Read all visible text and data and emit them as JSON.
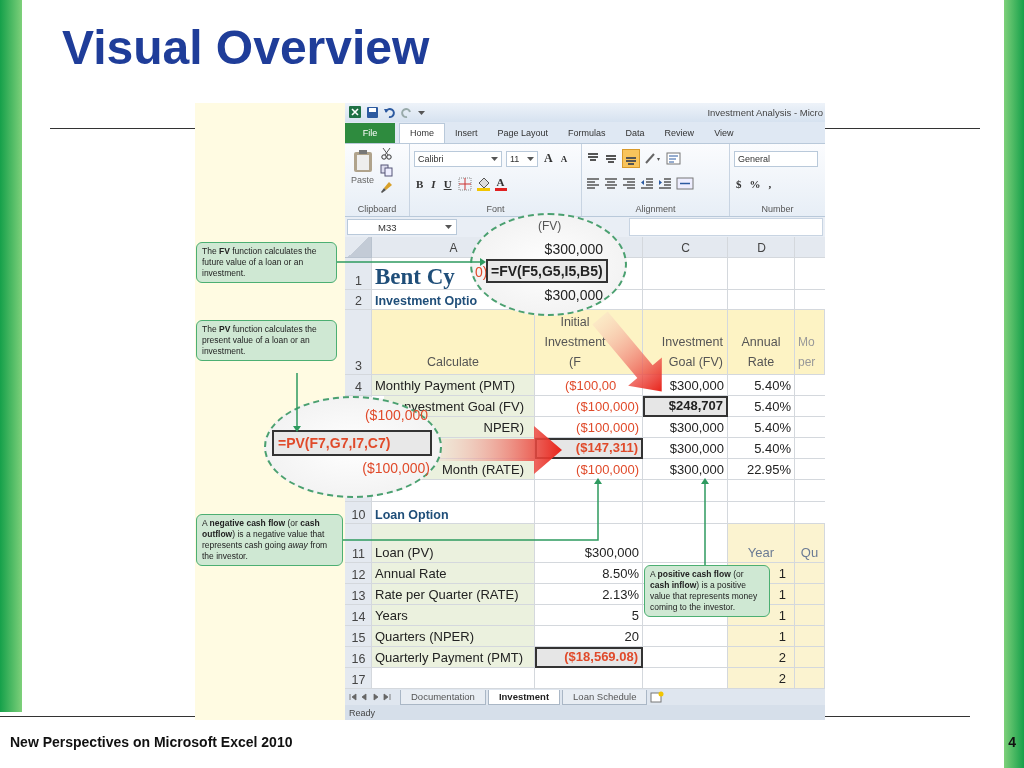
{
  "slide": {
    "title": "Visual Overview",
    "footer": "New Perspectives on Microsoft Excel 2010",
    "page_number": "4"
  },
  "excel": {
    "window_title": "Investment Analysis - Micro",
    "ribbon_tabs": [
      {
        "label": "File",
        "kind": "file",
        "selected": false
      },
      {
        "label": "Home",
        "kind": "tab",
        "selected": true
      },
      {
        "label": "Insert",
        "kind": "tab",
        "selected": false
      },
      {
        "label": "Page Layout",
        "kind": "tab",
        "selected": false
      },
      {
        "label": "Formulas",
        "kind": "tab",
        "selected": false
      },
      {
        "label": "Data",
        "kind": "tab",
        "selected": false
      },
      {
        "label": "Review",
        "kind": "tab",
        "selected": false
      },
      {
        "label": "View",
        "kind": "tab",
        "selected": false
      }
    ],
    "ribbon": {
      "paste": "Paste",
      "font_name": "Calibri",
      "font_size": "11",
      "grow": "A",
      "shrink": "A",
      "bold": "B",
      "italic": "I",
      "underline": "U",
      "font_color": "A",
      "bottom_align_selected": true,
      "number_format": "General",
      "currency": "$",
      "percent": "%",
      "comma": ",",
      "groups": [
        "Clipboard",
        "Font",
        "Alignment",
        "Number"
      ]
    },
    "name_box": "M33",
    "column_headers": {
      "a": "A",
      "c": "C",
      "d": "D"
    },
    "rows": [
      {
        "kind": "title",
        "number": "1",
        "a": {
          "kind": "title",
          "text": "Bent Cy"
        }
      },
      {
        "kind": "sub",
        "number": "2",
        "a": {
          "kind": "subtitle",
          "text": "Investment Optio"
        }
      },
      {
        "kind": "header",
        "number": "3",
        "a": {
          "kind": "header",
          "text": "Calculate"
        },
        "b": {
          "kind": "header",
          "text": "Initial Investment (F"
        },
        "c": {
          "kind": "header",
          "text": "Investment Goal (FV)"
        },
        "d": {
          "kind": "header",
          "text": "Annual Rate"
        },
        "e": {
          "kind": "faded",
          "text": "Mo per"
        }
      },
      {
        "kind": "data",
        "number": "4",
        "a": {
          "kind": "label",
          "text": "Monthly Payment (PMT)"
        },
        "b": {
          "kind": "negative-cut",
          "text": "($100,00"
        },
        "c": {
          "kind": "value",
          "text": "$300,000"
        },
        "d": {
          "kind": "value",
          "text": "5.40%"
        }
      },
      {
        "kind": "data",
        "a": {
          "kind": "label-cut",
          "text": "nvestment Goal (FV)"
        },
        "b": {
          "kind": "negative",
          "text": "($100,000)"
        },
        "c": {
          "kind": "result",
          "text": "$248,707"
        },
        "d": {
          "kind": "value",
          "text": "5.40%"
        }
      },
      {
        "kind": "data",
        "a": {
          "kind": "label-cut",
          "text": "NPER)"
        },
        "b": {
          "kind": "negative",
          "text": "($100,000)"
        },
        "c": {
          "kind": "value",
          "text": "$300,000"
        },
        "d": {
          "kind": "value",
          "text": "5.40%"
        }
      },
      {
        "kind": "data",
        "a": {
          "kind": "label"
        },
        "b": {
          "kind": "result-negative",
          "text": "($147,311)"
        },
        "c": {
          "kind": "value",
          "text": "$300,000"
        },
        "d": {
          "kind": "value",
          "text": "5.40%"
        }
      },
      {
        "kind": "data",
        "a": {
          "kind": "label-cut",
          "text": "Month (RATE)"
        },
        "b": {
          "kind": "negative",
          "text": "($100,000)"
        },
        "c": {
          "kind": "value",
          "text": "$300,000"
        },
        "d": {
          "kind": "value",
          "text": "22.95%"
        }
      },
      {
        "kind": "gap"
      },
      {
        "kind": "section",
        "number": "10",
        "a": {
          "kind": "subtitle",
          "text": "Loan Option"
        }
      },
      {
        "kind": "tall",
        "number": "11",
        "a": {
          "kind": "label",
          "text": "Loan (PV)"
        },
        "b": {
          "kind": "value",
          "text": "$300,000"
        },
        "d": {
          "kind": "table-head",
          "text": "Year"
        },
        "e": {
          "kind": "table-head",
          "text": "Qu"
        }
      },
      {
        "kind": "data",
        "number": "12",
        "a": {
          "kind": "label",
          "text": "Annual Rate"
        },
        "b": {
          "kind": "value",
          "text": "8.50%"
        },
        "d": {
          "kind": "table-value",
          "text": "1"
        },
        "e": {
          "kind": "table-value"
        }
      },
      {
        "kind": "data",
        "number": "13",
        "a": {
          "kind": "label",
          "text": "Rate per Quarter (RATE)"
        },
        "b": {
          "kind": "value",
          "text": "2.13%"
        },
        "d": {
          "kind": "table-value",
          "text": "1"
        },
        "e": {
          "kind": "table-value"
        }
      },
      {
        "kind": "data",
        "number": "14",
        "a": {
          "kind": "label",
          "text": "Years"
        },
        "b": {
          "kind": "value",
          "text": "5"
        },
        "d": {
          "kind": "table-value",
          "text": "1"
        },
        "e": {
          "kind": "table-value"
        }
      },
      {
        "kind": "data",
        "number": "15",
        "a": {
          "kind": "label",
          "text": "Quarters (NPER)"
        },
        "b": {
          "kind": "value",
          "text": "20"
        },
        "d": {
          "kind": "table-value",
          "text": "1"
        },
        "e": {
          "kind": "table-value"
        }
      },
      {
        "kind": "data",
        "number": "16",
        "a": {
          "kind": "label",
          "text": "Quarterly Payment (PMT)"
        },
        "b": {
          "kind": "result-negative",
          "text": "($18,569.08)"
        },
        "d": {
          "kind": "table-value",
          "text": "2"
        },
        "e": {
          "kind": "table-value"
        }
      },
      {
        "kind": "data",
        "number": "17",
        "d": {
          "kind": "table-value",
          "text": "2"
        },
        "e": {
          "kind": "table-value"
        }
      }
    ],
    "sheet_tabs": [
      {
        "label": "Documentation",
        "selected": false
      },
      {
        "label": "Investment",
        "selected": true
      },
      {
        "label": "Loan Schedule",
        "selected": false
      }
    ],
    "status": "Ready"
  },
  "magnifiers": [
    {
      "heading": "(FV)",
      "above": "$300,000",
      "side": "0)",
      "formula": "=FV(F5,G5,I5,B5)",
      "below": "$300,000",
      "negative": false
    },
    {
      "above": "($100,000",
      "formula": "=PV(F7,G7,I7,C7)",
      "below": "($100,000)",
      "negative": true
    }
  ],
  "callouts": [
    "The **FV** function calculates the future value of a loan or an investment.",
    "The **PV** function calculates the present value of a loan or an investment.",
    "A **negative cash flow** (or **cash outflow**) is a negative value that represents cash going *away* from the investor.",
    "A **positive cash flow** (or **cash inflow**) is a positive value that represents money coming to the investor."
  ]
}
